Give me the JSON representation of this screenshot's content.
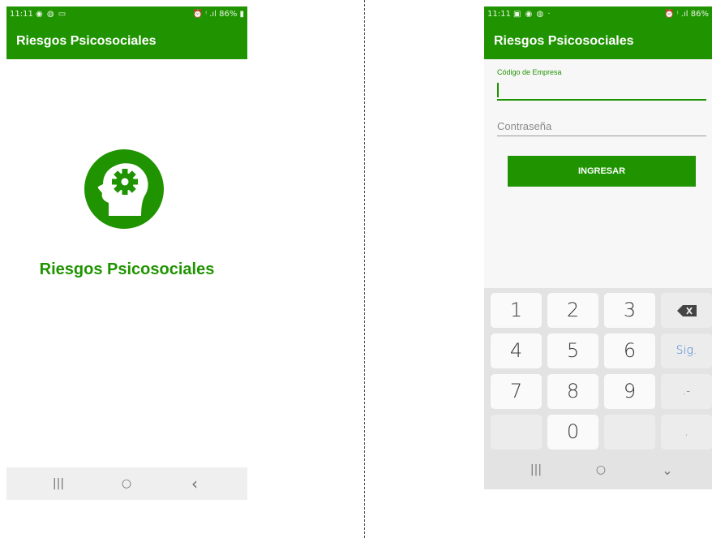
{
  "left": {
    "status": {
      "time": "11:11",
      "icons": "◉ ◍ ▭",
      "right": "⏰ ᵎ .ıl 86% ▮"
    },
    "appbar_title": "Riesgos Psicosociales",
    "splash_title": "Riesgos Psicosociales",
    "logo_icon": "head-with-gear-icon",
    "nav": {
      "recent": "|||",
      "home": "○",
      "back": "‹"
    }
  },
  "right": {
    "status": {
      "time": "11:11",
      "icons": "▣ ◉ ◍ ·",
      "right": "⏰ ᵎ .ıl 86%"
    },
    "appbar_title": "Riesgos Psicosociales",
    "form": {
      "company_label": "Código de Empresa",
      "company_value": "",
      "password_placeholder": "Contraseña",
      "submit_label": "INGRESAR"
    },
    "keypad": {
      "row1": [
        "1",
        "2",
        "3"
      ],
      "backspace_icon": "backspace-icon",
      "row2": [
        "4",
        "5",
        "6"
      ],
      "next_label": "Sig.",
      "row3": [
        "7",
        "8",
        "9"
      ],
      "punct_label": ".-",
      "zero": "0",
      "comma": ","
    },
    "nav": {
      "recent": "|||",
      "home": "○",
      "back": "⌄"
    }
  },
  "colors": {
    "brand": "#1f9400",
    "keyboard_bg": "#e3e3e3",
    "next_key": "#3a7bd5"
  }
}
